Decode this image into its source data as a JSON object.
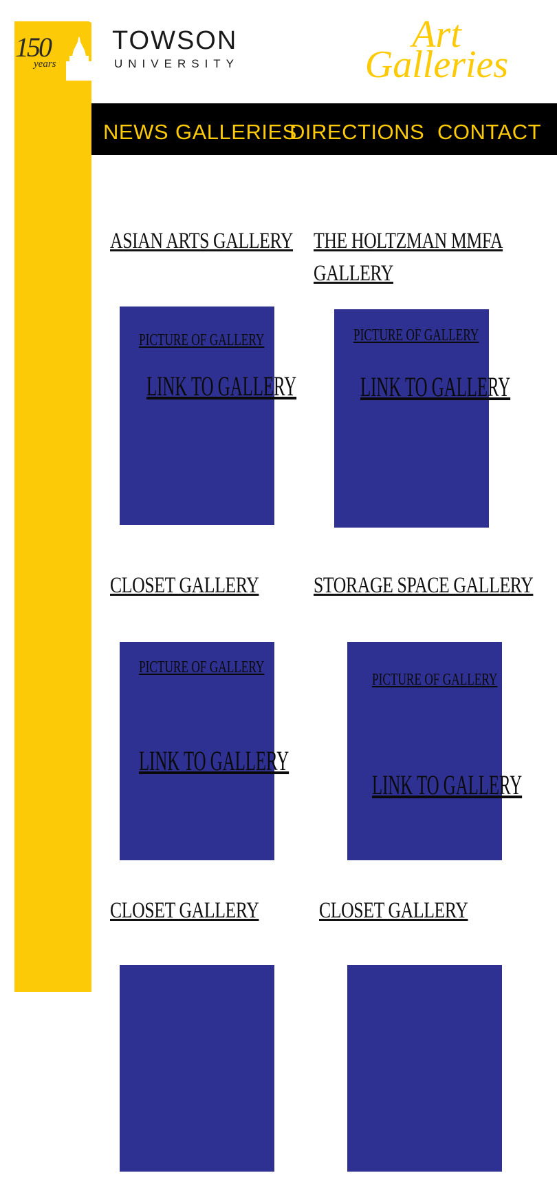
{
  "header": {
    "anniversary_number": "150",
    "anniversary_word": "years",
    "university_name": "TOWSON",
    "university_sub": "UNIVERSITY",
    "site_title_line1": "Art",
    "site_title_line2": "Galleries"
  },
  "nav": {
    "items": [
      {
        "label": "NEWS"
      },
      {
        "label": "GALLERIES"
      },
      {
        "label": "DIRECTIONS"
      },
      {
        "label": "CONTACT"
      }
    ]
  },
  "galleries": [
    {
      "title": "ASIAN  ARTS GALLERY",
      "picture_label": "PICTURE OF GALLERY",
      "link_label": "LINK TO GALLERY"
    },
    {
      "title_line1": "THE HOLTZMAN MMFA",
      "title_line2": "GALLERY",
      "picture_label": "PICTURE OF GALLERY",
      "link_label": "LINK TO GALLERY"
    },
    {
      "title": "CLOSET GALLERY",
      "picture_label": "PICTURE OF GALLERY",
      "link_label": "LINK TO GALLERY"
    },
    {
      "title": "STORAGE SPACE GALLERY",
      "picture_label": "PICTURE OF GALLERY",
      "link_label": "LINK TO GALLERY"
    },
    {
      "title": "CLOSET GALLERY"
    },
    {
      "title": "CLOSET GALLERY"
    }
  ],
  "colors": {
    "brand_gold": "#fdca07",
    "panel_blue": "#2e3192",
    "nav_background": "#000000"
  }
}
